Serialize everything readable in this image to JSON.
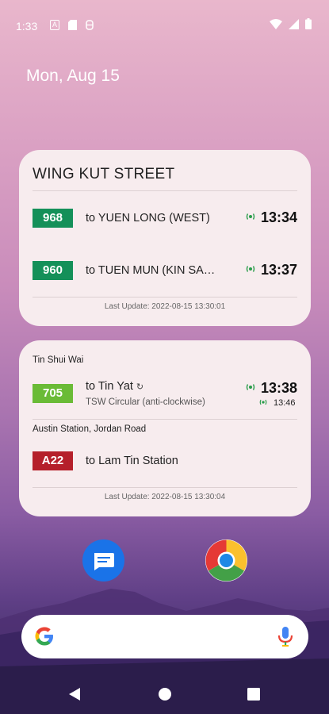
{
  "status_bar": {
    "time": "1:33"
  },
  "date": "Mon, Aug 15",
  "widget1": {
    "title": "WING KUT STREET",
    "rows": [
      {
        "route": "968",
        "dest": "to YUEN LONG (WEST)",
        "eta": "13:34",
        "color": "#149059"
      },
      {
        "route": "960",
        "dest": "to TUEN MUN (KIN SANG ESTATE)",
        "eta": "13:37",
        "color": "#149059"
      }
    ],
    "last_update": "Last Update: 2022-08-15 13:30:01"
  },
  "widget2": {
    "stop1": "Tin Shui Wai",
    "row1": {
      "route": "705",
      "dest": "to Tin Yat",
      "sub": "TSW Circular (anti-clockwise)",
      "eta": "13:38",
      "eta2": "13:46",
      "color": "#6abb36"
    },
    "stop2": "Austin Station, Jordan Road",
    "row2": {
      "route": "A22",
      "dest": "to Lam Tin Station",
      "color": "#b51f2a"
    },
    "last_update": "Last Update: 2022-08-15 13:30:04"
  },
  "dock": {
    "apps": [
      "messages-icon",
      "chrome-icon"
    ]
  },
  "icons": {
    "realtime": "realtime-signal-icon",
    "circular": "circular-route-icon"
  }
}
